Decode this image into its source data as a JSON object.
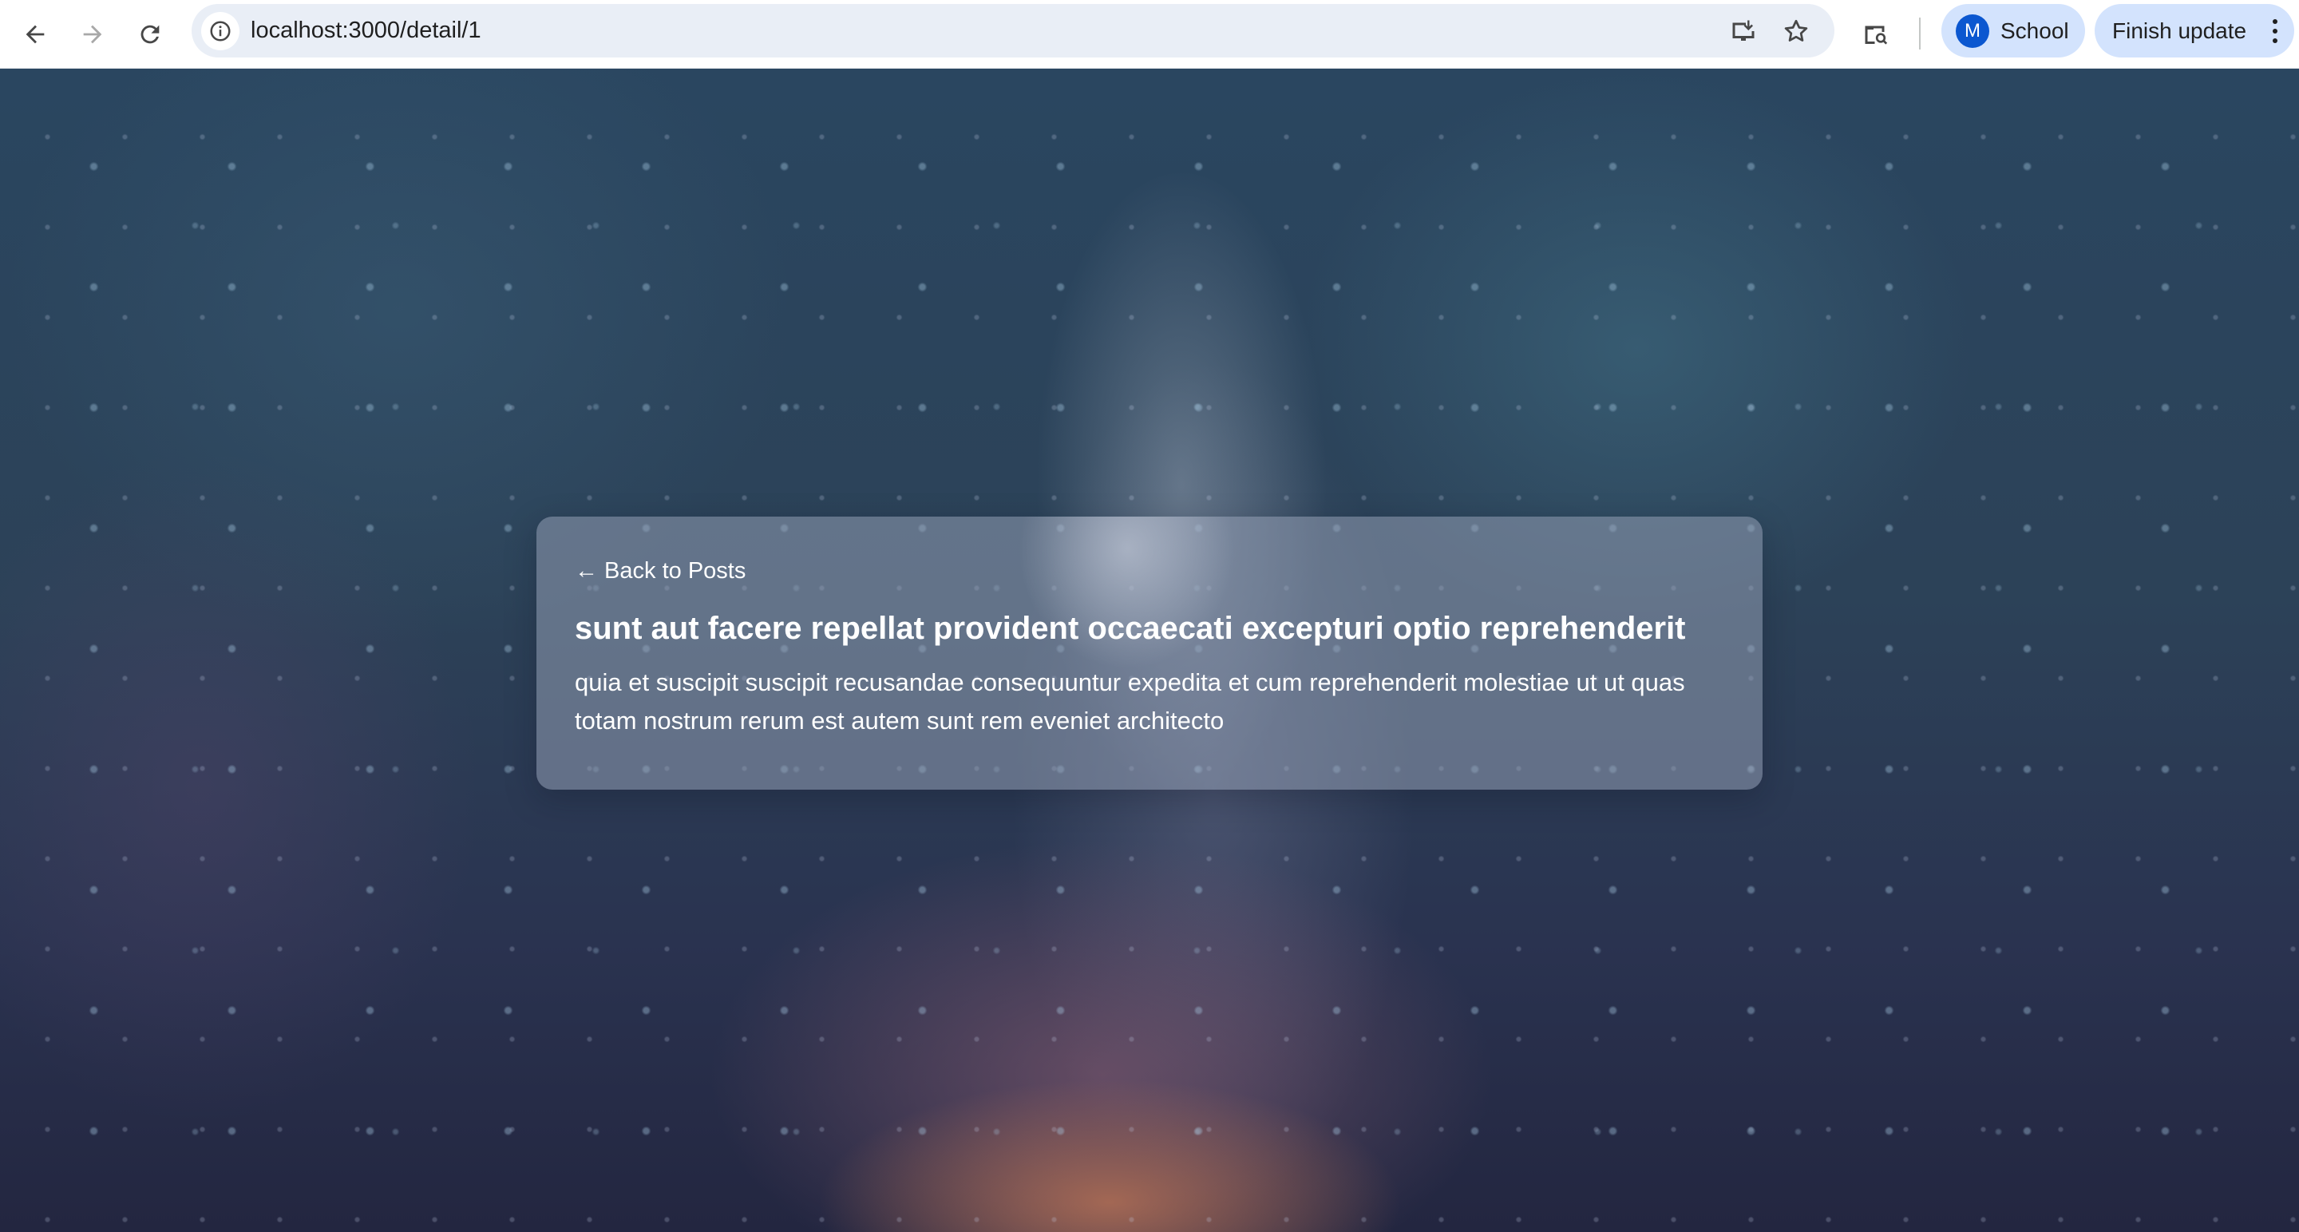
{
  "browser": {
    "url": "localhost:3000/detail/1",
    "profile": {
      "initial": "M",
      "name": "School"
    },
    "update_button": "Finish update",
    "icons": {
      "back": "arrow-left-icon",
      "forward": "arrow-right-icon",
      "reload": "reload-icon",
      "site_info": "info-icon",
      "install": "install-app-icon",
      "bookmark": "star-icon",
      "tab_search": "tab-search-icon",
      "menu": "kebab-menu-icon"
    }
  },
  "page": {
    "back_link": "← Back to Posts",
    "post": {
      "title": "sunt aut facere repellat provident occaecati excepturi optio reprehenderit",
      "body": "quia et suscipit suscipit recusandae consequuntur expedita et cum reprehenderit molestiae ut ut quas totam nostrum rerum est autem sunt rem eveniet architecto"
    }
  },
  "colors": {
    "toolbar_bg": "#ffffff",
    "omnibox_bg": "#e9eef6",
    "chip_bg": "#d3e3fd",
    "avatar_bg": "#0b57d0",
    "card_text": "#ffffff"
  }
}
